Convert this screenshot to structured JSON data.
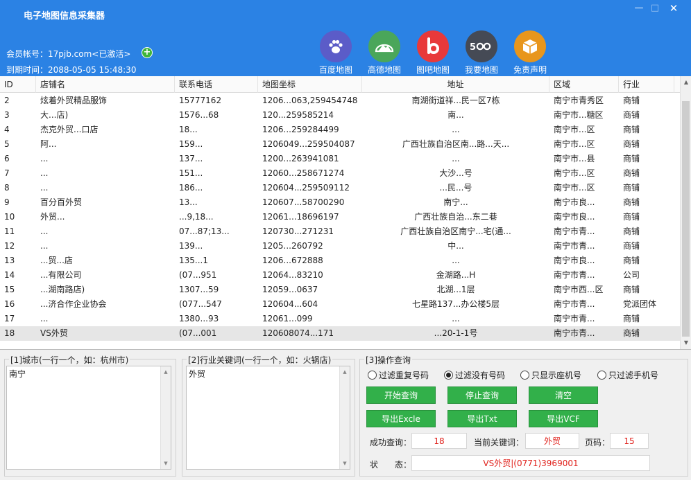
{
  "app": {
    "title": "电子地图信息采集器",
    "window_minimize": "—",
    "window_maximize": "□",
    "window_close": "✕"
  },
  "account": {
    "member_line": "会员帐号：17pjb.com<已激活>",
    "add_icon": "plus-circle-icon",
    "expire_line": "到期时间：2088-05-05 15:48:30"
  },
  "map_sources": [
    {
      "label": "百度地图",
      "icon": "paw-icon",
      "color": "#5b5cc8"
    },
    {
      "label": "高德地图",
      "icon": "mountain-icon",
      "color": "#4aa65a"
    },
    {
      "label": "图吧地图",
      "icon": "b-letter-icon",
      "color": "#e8393a"
    },
    {
      "label": "我要地图",
      "icon": "500-icon",
      "color": "#454a55"
    },
    {
      "label": "免责声明",
      "icon": "box-icon",
      "color": "#e8961c"
    }
  ],
  "table": {
    "columns": [
      "ID",
      "店铺名",
      "联系电话",
      "地图坐标",
      "地址",
      "区域",
      "行业"
    ],
    "rows": [
      {
        "id": "2",
        "name": "炫着外贸精品服饰",
        "phone": "15777162",
        "coord": "1206...063,259454748",
        "addr": "南湖街道祥...民一区7栋",
        "area": "南宁市青秀区",
        "industry": "商铺"
      },
      {
        "id": "3",
        "name": "大...店)",
        "phone": "1576...68",
        "coord": "120...259585214",
        "addr": "南...",
        "area": "南宁市...糖区",
        "industry": "商铺"
      },
      {
        "id": "4",
        "name": "杰克外贸...口店",
        "phone": "18...",
        "coord": "1206...259284499",
        "addr": "...",
        "area": "南宁市...区",
        "industry": "商铺"
      },
      {
        "id": "5",
        "name": "阿...",
        "phone": "159...",
        "coord": "1206049...259504087",
        "addr": "广西壮族自治区南...路...天...",
        "area": "南宁市...区",
        "industry": "商铺"
      },
      {
        "id": "6",
        "name": "...",
        "phone": "137...",
        "coord": "1200...263941081",
        "addr": "...",
        "area": "南宁市...县",
        "industry": "商铺"
      },
      {
        "id": "7",
        "name": "...",
        "phone": "151...",
        "coord": "12060...258671274",
        "addr": "大沙...号",
        "area": "南宁市...区",
        "industry": "商铺"
      },
      {
        "id": "8",
        "name": "...",
        "phone": "186...",
        "coord": "120604...259509112",
        "addr": "...民...号",
        "area": "南宁市...区",
        "industry": "商铺"
      },
      {
        "id": "9",
        "name": "百分百外贸",
        "phone": "13...",
        "coord": "120607...58700290",
        "addr": "南宁...",
        "area": "南宁市良...",
        "industry": "商铺"
      },
      {
        "id": "10",
        "name": "外贸...",
        "phone": "...9,18...",
        "coord": "12061...18696197",
        "addr": "广西壮族自治...东二巷",
        "area": "南宁市良...",
        "industry": "商铺"
      },
      {
        "id": "11",
        "name": "...",
        "phone": "07...87;13...",
        "coord": "120730...271231",
        "addr": "广西壮族自治区南宁...宅(通...",
        "area": "南宁市青...",
        "industry": "商铺"
      },
      {
        "id": "12",
        "name": "...",
        "phone": "139...",
        "coord": "1205...260792",
        "addr": "中...",
        "area": "南宁市青...",
        "industry": "商铺"
      },
      {
        "id": "13",
        "name": "...贸...店",
        "phone": "135...1",
        "coord": "1206...672888",
        "addr": "...",
        "area": "南宁市良...",
        "industry": "商铺"
      },
      {
        "id": "14",
        "name": "...有限公司",
        "phone": "(07...951",
        "coord": "12064...83210",
        "addr": "金湖路...H",
        "area": "南宁市青...",
        "industry": "公司"
      },
      {
        "id": "15",
        "name": "...湖南路店)",
        "phone": "1307...59",
        "coord": "12059...0637",
        "addr": "北湖...1层",
        "area": "南宁市西...区",
        "industry": "商铺"
      },
      {
        "id": "16",
        "name": "...济合作企业协会",
        "phone": "(077...547",
        "coord": "120604...604",
        "addr": "七星路137...办公楼5层",
        "area": "南宁市青...",
        "industry": "党派团体"
      },
      {
        "id": "17",
        "name": "...",
        "phone": "1380...93",
        "coord": "12061...099",
        "addr": "...",
        "area": "南宁市青...",
        "industry": "商铺"
      },
      {
        "id": "18",
        "name": "VS外贸",
        "phone": "(07...001",
        "coord": "120608074...171",
        "addr": "...20-1-1号",
        "area": "南宁市青...",
        "industry": "商铺"
      }
    ]
  },
  "panels": {
    "city": {
      "legend": "[1]城市(一行一个，如：杭州市)",
      "value": "南宁"
    },
    "keyword": {
      "legend": "[2]行业关键词(一行一个，如：火锅店)",
      "value": "外贸"
    },
    "ops": {
      "legend": "[3]操作查询"
    }
  },
  "filters": [
    {
      "label": "过滤重复号码",
      "checked": false
    },
    {
      "label": "过滤没有号码",
      "checked": true
    },
    {
      "label": "只显示座机号",
      "checked": false
    },
    {
      "label": "只过滤手机号",
      "checked": false
    }
  ],
  "buttons": {
    "start": "开始查询",
    "stop": "停止查询",
    "clear": "清空",
    "export_excel": "导出Excle",
    "export_txt": "导出Txt",
    "export_vcf": "导出VCF"
  },
  "stats": {
    "success_label": "成功查询：",
    "success_value": "18",
    "keyword_label": "当前关键词：",
    "keyword_value": "外贸",
    "page_label": "页码：",
    "page_value": "15",
    "status_label": "状　　态：",
    "status_value": "VS外贸|(0771)3969001"
  }
}
